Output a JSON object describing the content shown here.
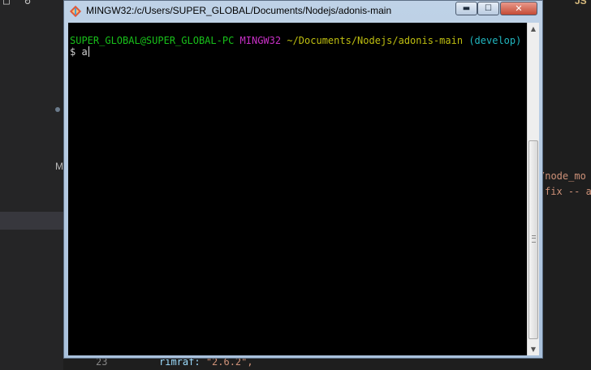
{
  "window": {
    "title": "MINGW32:/c/Users/SUPER_GLOBAL/Documents/Nodejs/adonis-main",
    "controls": {
      "minimize": "▬",
      "maximize": "☐",
      "close": "✕"
    }
  },
  "terminal": {
    "prompt_user": "SUPER_GLOBAL@SUPER_GLOBAL-PC",
    "prompt_system": "MINGW32",
    "prompt_path": "~/Documents/Nodejs/adonis-main",
    "prompt_branch": "(develop)",
    "input_symbol": "$",
    "input_text": "a"
  },
  "background_editor": {
    "top_badge": "JS",
    "code_line_1": "/node_mo",
    "code_line_2": "fix -- a",
    "sidebar_letter": "M",
    "bottom_line_number": "23",
    "bottom_code_key": "rimraf",
    "bottom_code_sep": ": ",
    "bottom_code_value": "\"2.6.2\",",
    "top_icon": "↻"
  },
  "colors": {
    "user": "#18c11a",
    "system": "#c930c7",
    "path": "#bfbf10",
    "branch": "#21b7c0"
  }
}
